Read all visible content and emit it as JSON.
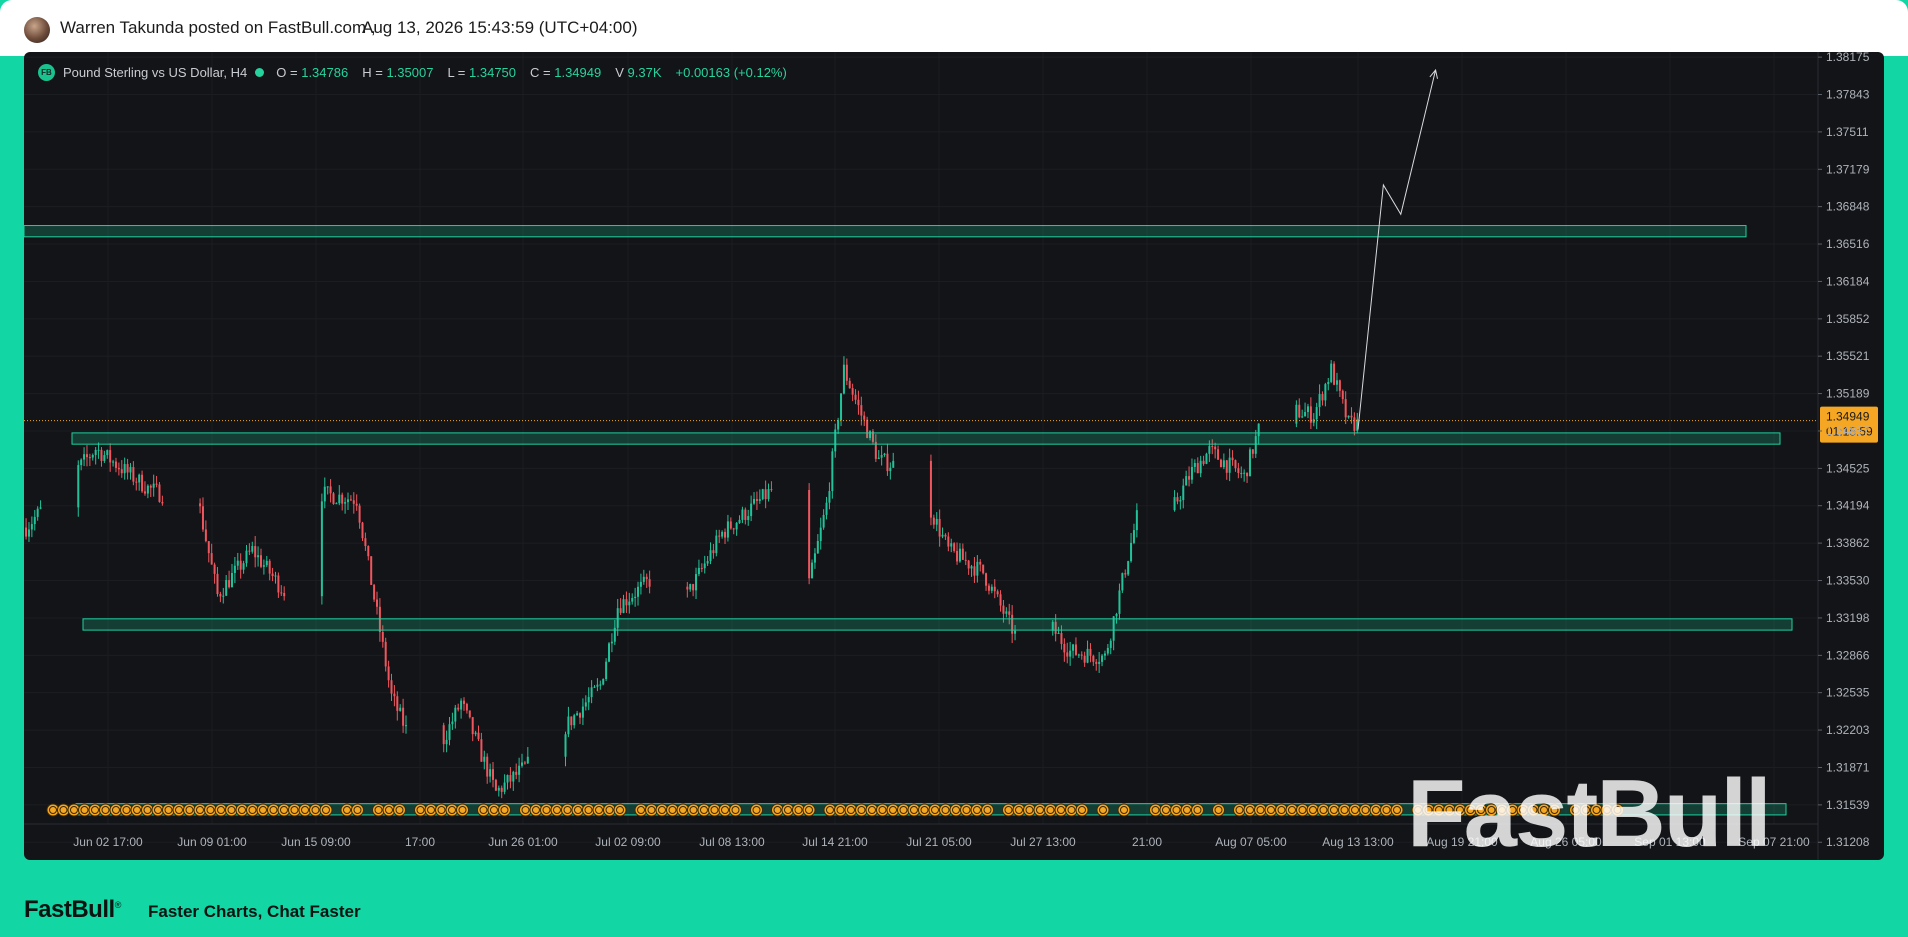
{
  "header": {
    "author_line": "Warren Takunda posted on FastBull.com  ,",
    "timestamp": "Aug 13, 2026 15:43:59 (UTC+04:00)"
  },
  "legend": {
    "badge": "FB",
    "symbol": "Pound Sterling vs US Dollar, H4",
    "open_label": "O =",
    "open": "1.34786",
    "high_label": "H =",
    "high": "1.35007",
    "low_label": "L =",
    "low": "1.34750",
    "close_label": "C =",
    "close": "1.34949",
    "volume_label": "V",
    "volume": "9.37K",
    "change": "+0.00163 (+0.12%)"
  },
  "colors": {
    "up": "#22c39a",
    "down": "#f0565e",
    "zone": "#1dd1a1",
    "price_tag": "#f5a623",
    "background": "#131417",
    "brand": "#12d6a4"
  },
  "watermark": "FastBull",
  "footer": {
    "logo": "FastBull",
    "logo_mark": "®",
    "tagline": "Faster Charts, Chat Faster"
  },
  "chart_data": {
    "type": "candlestick",
    "symbol": "Pound Sterling vs US Dollar",
    "timeframe": "H4",
    "ylim": [
      1.3105,
      1.3822
    ],
    "y_ticks": [
      "1.38175",
      "1.37843",
      "1.37511",
      "1.37179",
      "1.36848",
      "1.36516",
      "1.36184",
      "1.35852",
      "1.35521",
      "1.35189",
      "1.34857",
      "1.34525",
      "1.34194",
      "1.33862",
      "1.33530",
      "1.33198",
      "1.32866",
      "1.32535",
      "1.32203",
      "1.31871",
      "1.31539",
      "1.31208"
    ],
    "x_ticks": [
      "Jun 02 17:00",
      "Jun 09 01:00",
      "Jun 15 09:00",
      "17:00",
      "Jun 26 01:00",
      "Jul 02 09:00",
      "Jul 08 13:00",
      "Jul 14 21:00",
      "Jul 21 05:00",
      "Jul 27 13:00",
      "21:00",
      "Aug 07 05:00",
      "Aug 13 13:00",
      "Aug 19 21:00",
      "Aug 26 05:00",
      "Sep 01 13:00",
      "Sep 07 21:00"
    ],
    "last_price": "1.34949",
    "countdown": "01:15:59",
    "zones": [
      {
        "name": "upper-target-zone",
        "top": 1.3668,
        "bottom": 1.3658
      },
      {
        "name": "resistance-zone",
        "top": 1.3484,
        "bottom": 1.3474
      },
      {
        "name": "support-zone",
        "top": 1.3319,
        "bottom": 1.3309
      },
      {
        "name": "lower-support-zone",
        "top": 1.3155,
        "bottom": 1.3145
      }
    ],
    "forecast_path": [
      [
        "Aug 13 13:00",
        1.3487
      ],
      [
        "Aug 15",
        1.3704
      ],
      [
        "Aug 16",
        1.3678
      ],
      [
        "Aug 18",
        1.3806
      ]
    ],
    "anchors": [
      [
        "May 29",
        1.34
      ],
      [
        "Jun 02",
        1.347
      ],
      [
        "Jun 05",
        1.3435
      ],
      [
        "Jun 08",
        1.3415
      ],
      [
        "Jun 09",
        1.334
      ],
      [
        "Jun 11",
        1.338
      ],
      [
        "Jun 13",
        1.334
      ],
      [
        "Jun 15",
        1.343
      ],
      [
        "Jun 17",
        1.3425
      ],
      [
        "Jun 19",
        1.325
      ],
      [
        "Jun 21",
        1.318
      ],
      [
        "Jun 23",
        1.3245
      ],
      [
        "Jun 25",
        1.3165
      ],
      [
        "Jun 28",
        1.3205
      ],
      [
        "Jul 01",
        1.326
      ],
      [
        "Jul 02",
        1.333
      ],
      [
        "Jul 04",
        1.3355
      ],
      [
        "Jul 06",
        1.334
      ],
      [
        "Jul 08",
        1.3395
      ],
      [
        "Jul 11",
        1.3435
      ],
      [
        "Jul 13",
        1.335
      ],
      [
        "Jul 14",
        1.342
      ],
      [
        "Jul 15",
        1.354
      ],
      [
        "Jul 17",
        1.346
      ],
      [
        "Jul 19",
        1.345
      ],
      [
        "Jul 21",
        1.338
      ],
      [
        "Jul 23",
        1.336
      ],
      [
        "Jul 25",
        1.33
      ],
      [
        "Jul 26",
        1.333
      ],
      [
        "Jul 28",
        1.329
      ],
      [
        "Jul 30",
        1.3285
      ],
      [
        "Aug 01",
        1.342
      ],
      [
        "Aug 02",
        1.3475
      ],
      [
        "Aug 03",
        1.342
      ],
      [
        "Aug 04",
        1.345
      ],
      [
        "Aug 05",
        1.3468
      ],
      [
        "Aug 07",
        1.3445
      ],
      [
        "Aug 08",
        1.3495
      ],
      [
        "Aug 10",
        1.3503
      ],
      [
        "Aug 11",
        1.35
      ],
      [
        "Aug 12",
        1.354
      ],
      [
        "Aug 13",
        1.3492
      ]
    ]
  }
}
